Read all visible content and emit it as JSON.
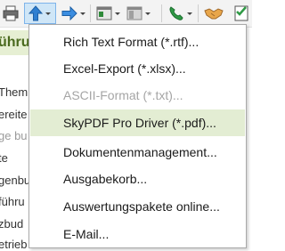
{
  "toolbar": {
    "buttons": [
      {
        "name": "print-icon"
      },
      {
        "name": "export-up-arrow-icon",
        "pressed": true
      },
      {
        "name": "forward-arrow-icon"
      },
      {
        "name": "document-view-icon"
      },
      {
        "name": "table-view-icon"
      },
      {
        "name": "phone-icon"
      },
      {
        "name": "handshake-icon"
      },
      {
        "name": "checklist-icon"
      }
    ]
  },
  "background": {
    "header": "ühru",
    "rows": [
      "Them",
      "ereite",
      "ge bu",
      "te",
      "genbu",
      "führu",
      "zbud",
      "etrieb"
    ]
  },
  "menu": {
    "items": [
      {
        "label": "Rich Text Format (*.rtf)...",
        "state": "normal"
      },
      {
        "label": "Excel-Export (*.xlsx)...",
        "state": "normal"
      },
      {
        "label": "ASCII-Format (*.txt)...",
        "state": "disabled"
      },
      {
        "label": "SkyPDF Pro Driver (*.pdf)...",
        "state": "highlight"
      },
      {
        "label": "Dokumentenmanagement...",
        "state": "normal"
      },
      {
        "label": "Ausgabekorb...",
        "state": "normal"
      },
      {
        "label": "Auswertungspakete online...",
        "state": "normal"
      },
      {
        "label": "E-Mail...",
        "state": "normal"
      }
    ]
  },
  "colors": {
    "highlight": "#e3edd3",
    "accent_blue": "#2f7fd1",
    "header_green": "#4a6a1e"
  }
}
